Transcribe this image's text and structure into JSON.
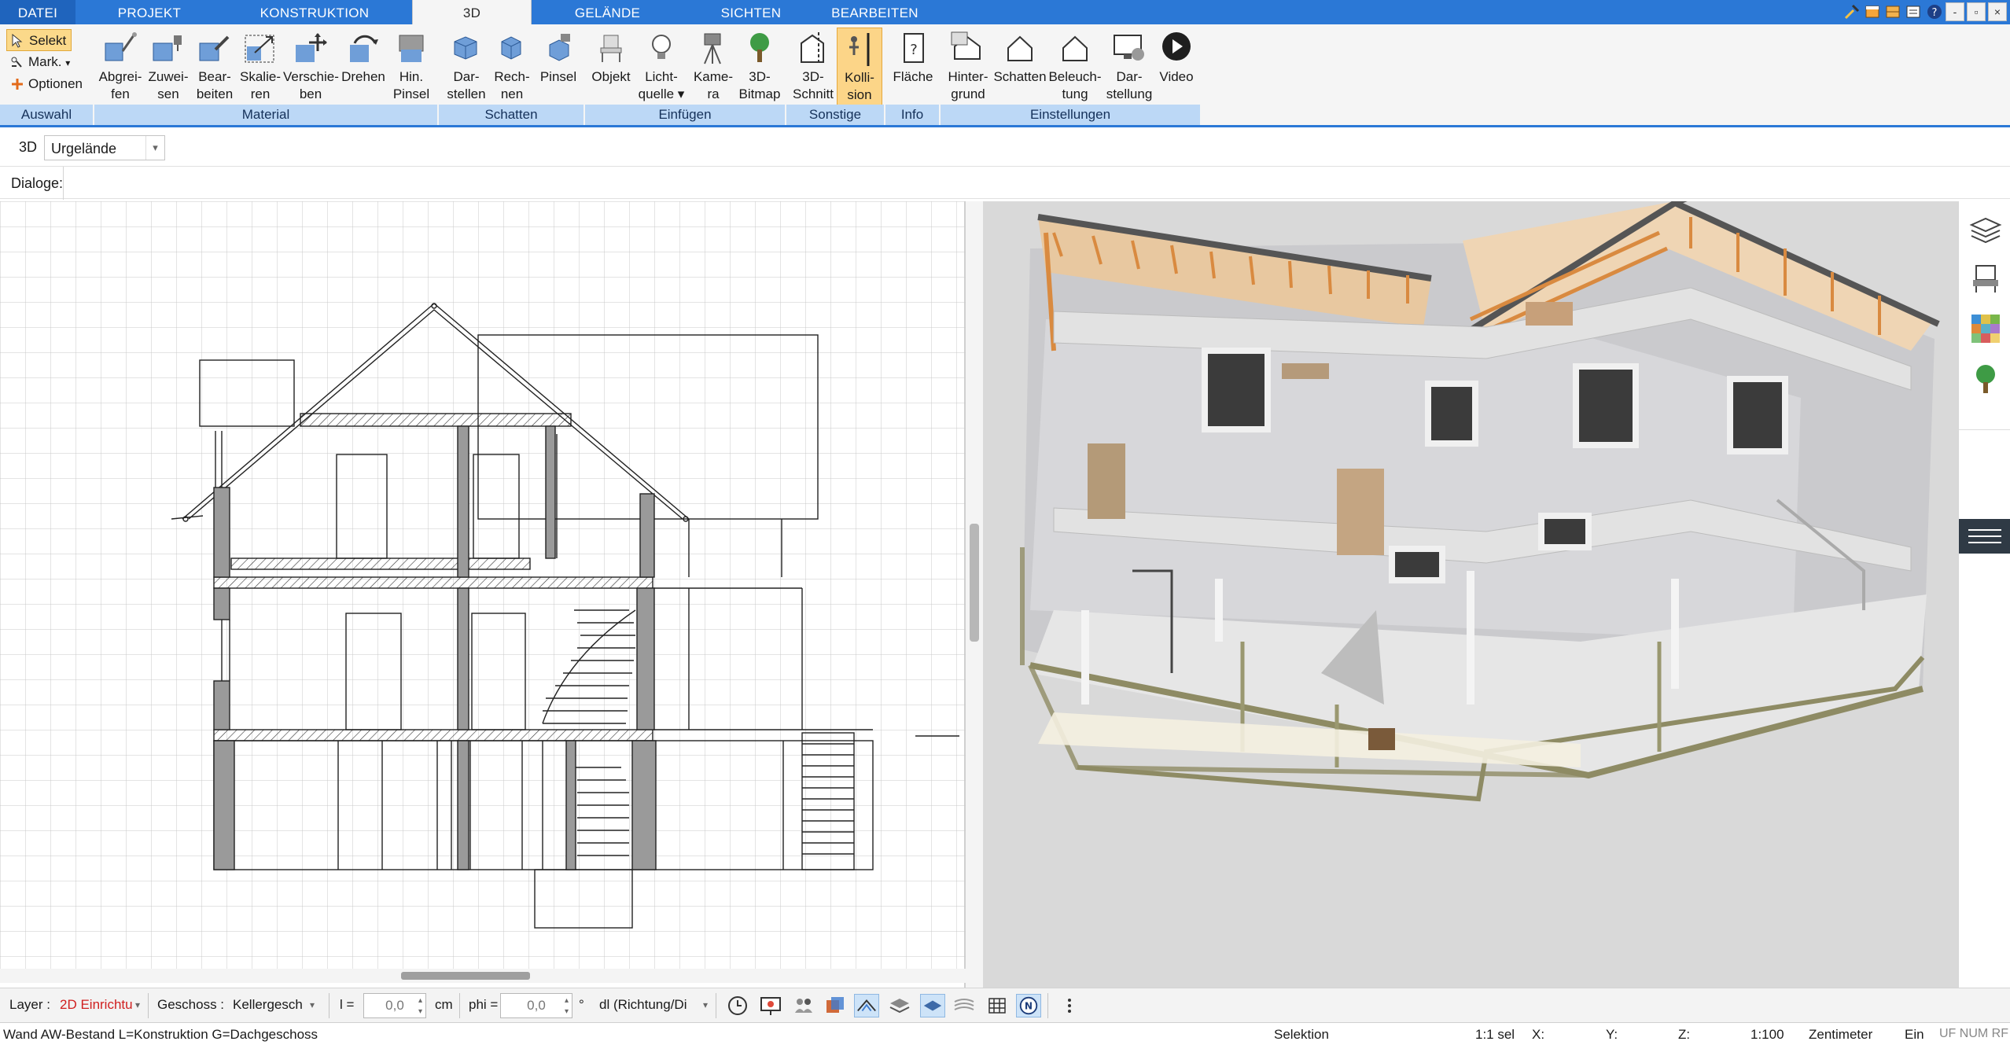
{
  "tabs": [
    {
      "label": "DATEI"
    },
    {
      "label": "PROJEKT"
    },
    {
      "label": "KONSTRUKTION"
    },
    {
      "label": "3D"
    },
    {
      "label": "GELÄNDE"
    },
    {
      "label": "SICHTEN"
    },
    {
      "label": "BEARBEITEN"
    }
  ],
  "active_tab": "3D",
  "window_buttons": {
    "minimize": "-",
    "restore": "▫",
    "close": "×"
  },
  "selection_panel": {
    "items": [
      {
        "label": "Selekt",
        "icon": "cursor-select-icon"
      },
      {
        "label": "Mark.",
        "icon": "mark-icon"
      },
      {
        "label": "Optionen",
        "icon": "plus-icon"
      }
    ]
  },
  "ribbon": {
    "buttons": [
      {
        "label": "Abgrei-\nfen",
        "icon": "pick-material-icon"
      },
      {
        "label": "Zuwei-\nsen",
        "icon": "assign-material-icon"
      },
      {
        "label": "Bear-\nbeiten",
        "icon": "edit-material-icon"
      },
      {
        "label": "Skalie-\nren",
        "icon": "scale-material-icon"
      },
      {
        "label": "Verschie-\nben",
        "icon": "move-material-icon"
      },
      {
        "label": "Drehen",
        "icon": "rotate-material-icon"
      },
      {
        "label": "Hin.\nPinsel",
        "icon": "brush-material-icon"
      },
      {
        "label": "Dar-\nstellen",
        "icon": "show-shadow-icon"
      },
      {
        "label": "Rech-\nnen",
        "icon": "calc-shadow-icon"
      },
      {
        "label": "Pinsel",
        "icon": "shadow-brush-icon"
      },
      {
        "label": "Objekt",
        "icon": "chair-object-icon"
      },
      {
        "label": "Licht-\nquelle ▾",
        "icon": "light-bulb-icon"
      },
      {
        "label": "Kame-\nra",
        "icon": "camera-icon"
      },
      {
        "label": "3D-\nBitmap",
        "icon": "tree-bitmap-icon"
      },
      {
        "label": "3D-\nSchnitt",
        "icon": "section-cut-icon"
      },
      {
        "label": "Kolli-\nsion",
        "icon": "collision-icon"
      },
      {
        "label": "Fläche",
        "icon": "area-info-icon"
      },
      {
        "label": "Hinter-\ngrund",
        "icon": "background-icon"
      },
      {
        "label": "Schatten",
        "icon": "shadow-house-icon"
      },
      {
        "label": "Beleuch-\ntung",
        "icon": "lighting-house-icon"
      },
      {
        "label": "Dar-\nstellung",
        "icon": "display-settings-icon"
      },
      {
        "label": "Video",
        "icon": "video-play-icon"
      }
    ],
    "groups": [
      {
        "label": "Auswahl"
      },
      {
        "label": "Material"
      },
      {
        "label": "Schatten"
      },
      {
        "label": "Einfügen"
      },
      {
        "label": "Sonstige"
      },
      {
        "label": "Info"
      },
      {
        "label": "Einstellungen"
      }
    ]
  },
  "viewbar": {
    "mode": "3D",
    "terrain_select": "Urgelände"
  },
  "dialogbar": {
    "label": "Dialoge:"
  },
  "bottom": {
    "layer_label": "Layer :",
    "layer_value": "2D Einrichtu",
    "geschoss_label": "Geschoss :",
    "geschoss_value": "Kellergesch",
    "l_label": "l =",
    "l_value": "0,0",
    "l_unit": "cm",
    "phi_label": "phi =",
    "phi_value": "0,0",
    "phi_unit": "°",
    "dl_value": "dl (Richtung/Di"
  },
  "status": {
    "left": "Wand AW-Bestand L=Konstruktion G=Dachgeschoss",
    "mode": "Selektion",
    "sel": "1:1 sel",
    "x": "X:",
    "y": "Y:",
    "z": "Z:",
    "scale": "1:100",
    "unit": "Zentimeter",
    "ein": "Ein",
    "flags": "UF NUM RF"
  }
}
